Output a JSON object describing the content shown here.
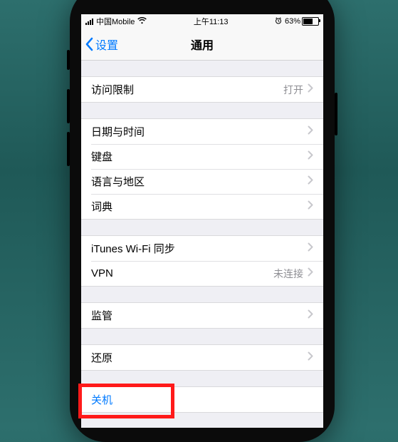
{
  "status": {
    "carrier": "中国Mobile",
    "time": "上午11:13",
    "battery_pct": "63%"
  },
  "nav": {
    "back_label": "设置",
    "title": "通用"
  },
  "groups": [
    {
      "rows": [
        {
          "label": "访问限制",
          "detail": "打开",
          "chevron": true
        }
      ]
    },
    {
      "rows": [
        {
          "label": "日期与时间",
          "detail": "",
          "chevron": true
        },
        {
          "label": "键盘",
          "detail": "",
          "chevron": true
        },
        {
          "label": "语言与地区",
          "detail": "",
          "chevron": true
        },
        {
          "label": "词典",
          "detail": "",
          "chevron": true
        }
      ]
    },
    {
      "rows": [
        {
          "label": "iTunes Wi-Fi 同步",
          "detail": "",
          "chevron": true
        },
        {
          "label": "VPN",
          "detail": "未连接",
          "chevron": true
        }
      ]
    },
    {
      "rows": [
        {
          "label": "监管",
          "detail": "",
          "chevron": true
        }
      ]
    },
    {
      "rows": [
        {
          "label": "还原",
          "detail": "",
          "chevron": true
        }
      ]
    },
    {
      "rows": [
        {
          "label": "关机",
          "detail": "",
          "chevron": false,
          "link": true
        }
      ]
    }
  ],
  "highlight_target": "关机"
}
